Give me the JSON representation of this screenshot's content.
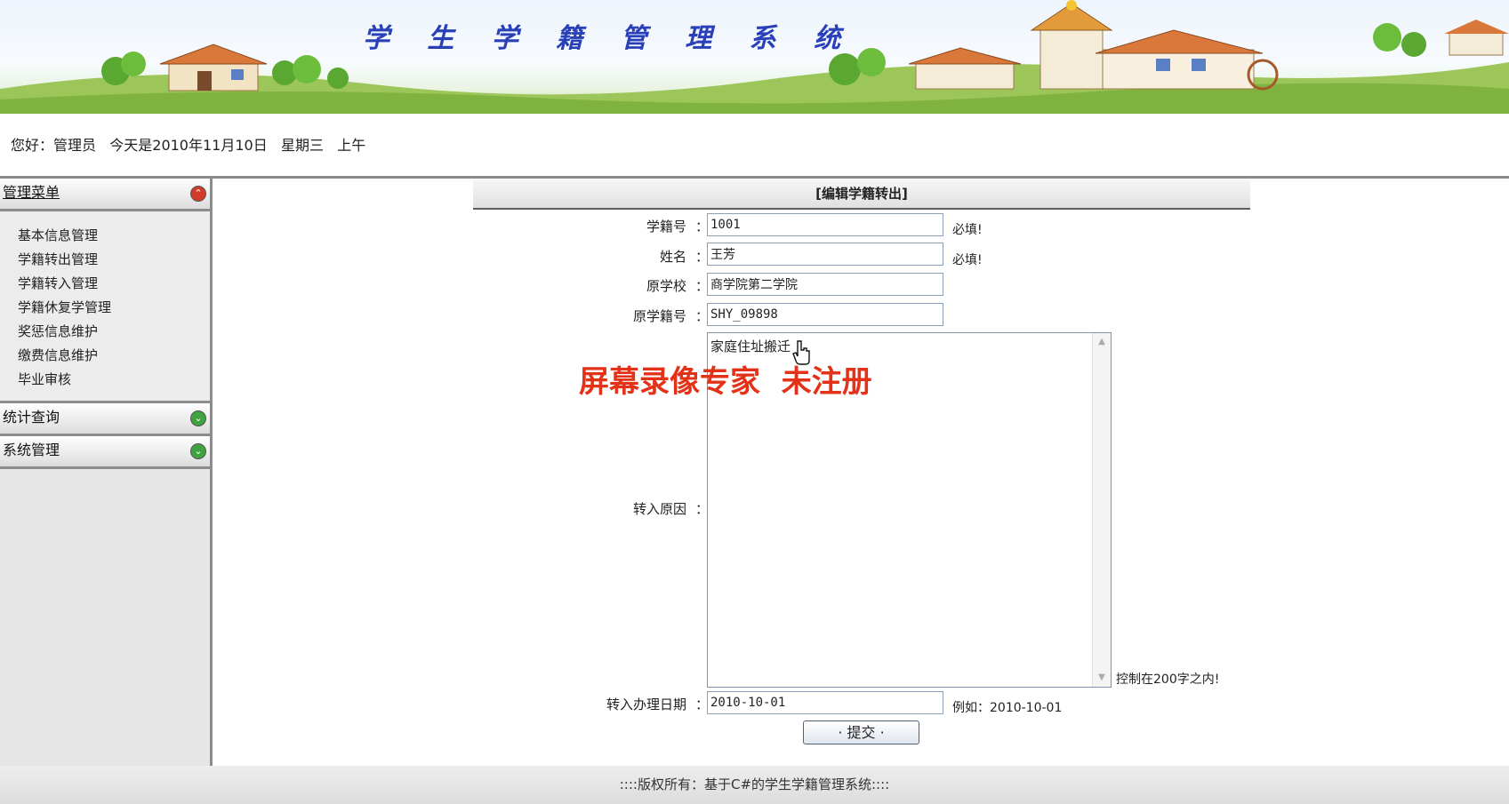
{
  "banner": {
    "title": "学 生 学 籍 管 理 系 统"
  },
  "greeting": {
    "text": "您好：管理员   今天是2010年11月10日   星期三   上午"
  },
  "sidebar": {
    "sections": [
      {
        "label": "管理菜单",
        "expanded": true
      },
      {
        "label": "统计查询",
        "expanded": false
      },
      {
        "label": "系统管理",
        "expanded": false
      }
    ],
    "items": [
      {
        "label": "基本信息管理"
      },
      {
        "label": "学籍转出管理"
      },
      {
        "label": "学籍转入管理"
      },
      {
        "label": "学籍休复学管理"
      },
      {
        "label": "奖惩信息维护"
      },
      {
        "label": "缴费信息维护"
      },
      {
        "label": "毕业审核"
      }
    ]
  },
  "form": {
    "title": "[编辑学籍转出]",
    "fields": {
      "student_no": {
        "label": "学籍号",
        "value": "1001",
        "hint": "必填!"
      },
      "name": {
        "label": "姓名",
        "value": "王芳",
        "hint": "必填!"
      },
      "orig_school": {
        "label": "原学校",
        "value": "商学院第二学院"
      },
      "orig_no": {
        "label": "原学籍号",
        "value": "SHY_09898"
      },
      "reason": {
        "label": "转入原因",
        "value": "家庭住址搬迁",
        "hint": "控制在200字之内!"
      },
      "date": {
        "label": "转入办理日期",
        "value": "2010-10-01",
        "hint": "例如：2010-10-01"
      }
    },
    "colon": "：",
    "submit_label": "· 提交 ·"
  },
  "watermark": {
    "text": "屏幕录像专家  未注册"
  },
  "footer": {
    "text": "::::版权所有：基于C#的学生学籍管理系统::::"
  },
  "colors": {
    "accent_title": "#2a40b8",
    "watermark": "#e33218",
    "toggle_red": "#d23a2a",
    "toggle_green": "#3fa33f"
  }
}
